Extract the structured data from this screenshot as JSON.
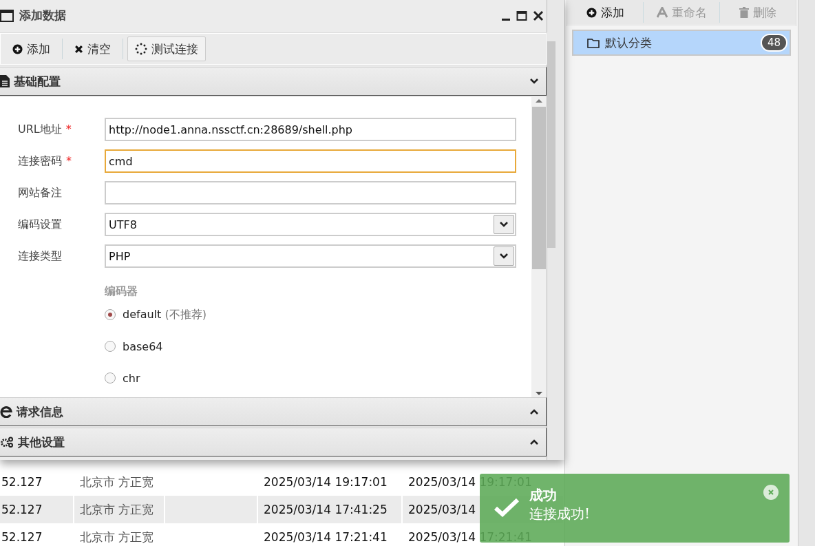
{
  "dialog": {
    "title": "添加数据",
    "toolbar": [
      {
        "label": "添加",
        "selected": false
      },
      {
        "label": "清空",
        "selected": false
      },
      {
        "label": "测试连接",
        "selected": true
      }
    ],
    "basic_section": {
      "title": "基础配置",
      "expanded": true,
      "fields": [
        {
          "kind": "text",
          "label": "URL地址",
          "required_mark": "*",
          "value": "http://node1.anna.nssctf.cn:28689/shell.php"
        },
        {
          "kind": "text",
          "label": "连接密码",
          "required_mark": "*",
          "value": "cmd",
          "focused": true
        },
        {
          "kind": "text",
          "label": "网站备注"
        },
        {
          "kind": "select",
          "label": "编码设置",
          "value": "UTF8"
        },
        {
          "kind": "select",
          "label": "连接类型",
          "value": "PHP"
        }
      ],
      "encoder": {
        "label": "编码器",
        "options": [
          {
            "label": "default",
            "note": "(不推荐)",
            "selected": true
          },
          {
            "label": "base64",
            "selected": false
          },
          {
            "label": "chr",
            "selected": false
          }
        ]
      }
    },
    "other_sections": [
      {
        "title": "请求信息",
        "expanded": false
      },
      {
        "title": "其他设置",
        "expanded": false
      }
    ]
  },
  "category_panel": {
    "toolbar": [
      {
        "label": "添加",
        "disabled": false
      },
      {
        "label": "重命名",
        "disabled": true
      },
      {
        "label": "删除",
        "disabled": true
      }
    ],
    "categories": [
      {
        "label": "默认分类",
        "count": "48",
        "selected": true
      }
    ]
  },
  "table": {
    "rows": [
      {
        "cells": [
          "52.127",
          "北京市 方正宽",
          "",
          "2025/03/14 19:17:01",
          "2025/03/14 19:17:01"
        ]
      },
      {
        "cells": [
          "52.127",
          "北京市 方正宽",
          "",
          "2025/03/14 17:41:25",
          "2025/03/14"
        ]
      },
      {
        "cells": [
          "52.127",
          "北京市 方正宽",
          "",
          "2025/03/14 17:21:41",
          "2025/03/14 17:21:41"
        ]
      }
    ]
  },
  "toast": {
    "title": "成功",
    "message": "连接成功!"
  }
}
